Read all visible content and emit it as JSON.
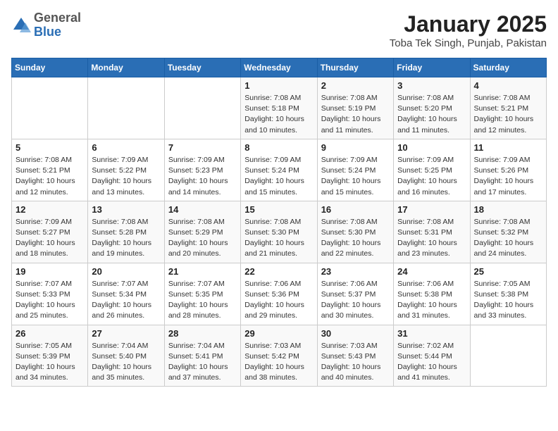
{
  "logo": {
    "general": "General",
    "blue": "Blue"
  },
  "header": {
    "month": "January 2025",
    "location": "Toba Tek Singh, Punjab, Pakistan"
  },
  "weekdays": [
    "Sunday",
    "Monday",
    "Tuesday",
    "Wednesday",
    "Thursday",
    "Friday",
    "Saturday"
  ],
  "weeks": [
    [
      {
        "day": "",
        "info": ""
      },
      {
        "day": "",
        "info": ""
      },
      {
        "day": "",
        "info": ""
      },
      {
        "day": "1",
        "info": "Sunrise: 7:08 AM\nSunset: 5:18 PM\nDaylight: 10 hours\nand 10 minutes."
      },
      {
        "day": "2",
        "info": "Sunrise: 7:08 AM\nSunset: 5:19 PM\nDaylight: 10 hours\nand 11 minutes."
      },
      {
        "day": "3",
        "info": "Sunrise: 7:08 AM\nSunset: 5:20 PM\nDaylight: 10 hours\nand 11 minutes."
      },
      {
        "day": "4",
        "info": "Sunrise: 7:08 AM\nSunset: 5:21 PM\nDaylight: 10 hours\nand 12 minutes."
      }
    ],
    [
      {
        "day": "5",
        "info": "Sunrise: 7:08 AM\nSunset: 5:21 PM\nDaylight: 10 hours\nand 12 minutes."
      },
      {
        "day": "6",
        "info": "Sunrise: 7:09 AM\nSunset: 5:22 PM\nDaylight: 10 hours\nand 13 minutes."
      },
      {
        "day": "7",
        "info": "Sunrise: 7:09 AM\nSunset: 5:23 PM\nDaylight: 10 hours\nand 14 minutes."
      },
      {
        "day": "8",
        "info": "Sunrise: 7:09 AM\nSunset: 5:24 PM\nDaylight: 10 hours\nand 15 minutes."
      },
      {
        "day": "9",
        "info": "Sunrise: 7:09 AM\nSunset: 5:24 PM\nDaylight: 10 hours\nand 15 minutes."
      },
      {
        "day": "10",
        "info": "Sunrise: 7:09 AM\nSunset: 5:25 PM\nDaylight: 10 hours\nand 16 minutes."
      },
      {
        "day": "11",
        "info": "Sunrise: 7:09 AM\nSunset: 5:26 PM\nDaylight: 10 hours\nand 17 minutes."
      }
    ],
    [
      {
        "day": "12",
        "info": "Sunrise: 7:09 AM\nSunset: 5:27 PM\nDaylight: 10 hours\nand 18 minutes."
      },
      {
        "day": "13",
        "info": "Sunrise: 7:08 AM\nSunset: 5:28 PM\nDaylight: 10 hours\nand 19 minutes."
      },
      {
        "day": "14",
        "info": "Sunrise: 7:08 AM\nSunset: 5:29 PM\nDaylight: 10 hours\nand 20 minutes."
      },
      {
        "day": "15",
        "info": "Sunrise: 7:08 AM\nSunset: 5:30 PM\nDaylight: 10 hours\nand 21 minutes."
      },
      {
        "day": "16",
        "info": "Sunrise: 7:08 AM\nSunset: 5:30 PM\nDaylight: 10 hours\nand 22 minutes."
      },
      {
        "day": "17",
        "info": "Sunrise: 7:08 AM\nSunset: 5:31 PM\nDaylight: 10 hours\nand 23 minutes."
      },
      {
        "day": "18",
        "info": "Sunrise: 7:08 AM\nSunset: 5:32 PM\nDaylight: 10 hours\nand 24 minutes."
      }
    ],
    [
      {
        "day": "19",
        "info": "Sunrise: 7:07 AM\nSunset: 5:33 PM\nDaylight: 10 hours\nand 25 minutes."
      },
      {
        "day": "20",
        "info": "Sunrise: 7:07 AM\nSunset: 5:34 PM\nDaylight: 10 hours\nand 26 minutes."
      },
      {
        "day": "21",
        "info": "Sunrise: 7:07 AM\nSunset: 5:35 PM\nDaylight: 10 hours\nand 28 minutes."
      },
      {
        "day": "22",
        "info": "Sunrise: 7:06 AM\nSunset: 5:36 PM\nDaylight: 10 hours\nand 29 minutes."
      },
      {
        "day": "23",
        "info": "Sunrise: 7:06 AM\nSunset: 5:37 PM\nDaylight: 10 hours\nand 30 minutes."
      },
      {
        "day": "24",
        "info": "Sunrise: 7:06 AM\nSunset: 5:38 PM\nDaylight: 10 hours\nand 31 minutes."
      },
      {
        "day": "25",
        "info": "Sunrise: 7:05 AM\nSunset: 5:38 PM\nDaylight: 10 hours\nand 33 minutes."
      }
    ],
    [
      {
        "day": "26",
        "info": "Sunrise: 7:05 AM\nSunset: 5:39 PM\nDaylight: 10 hours\nand 34 minutes."
      },
      {
        "day": "27",
        "info": "Sunrise: 7:04 AM\nSunset: 5:40 PM\nDaylight: 10 hours\nand 35 minutes."
      },
      {
        "day": "28",
        "info": "Sunrise: 7:04 AM\nSunset: 5:41 PM\nDaylight: 10 hours\nand 37 minutes."
      },
      {
        "day": "29",
        "info": "Sunrise: 7:03 AM\nSunset: 5:42 PM\nDaylight: 10 hours\nand 38 minutes."
      },
      {
        "day": "30",
        "info": "Sunrise: 7:03 AM\nSunset: 5:43 PM\nDaylight: 10 hours\nand 40 minutes."
      },
      {
        "day": "31",
        "info": "Sunrise: 7:02 AM\nSunset: 5:44 PM\nDaylight: 10 hours\nand 41 minutes."
      },
      {
        "day": "",
        "info": ""
      }
    ]
  ]
}
